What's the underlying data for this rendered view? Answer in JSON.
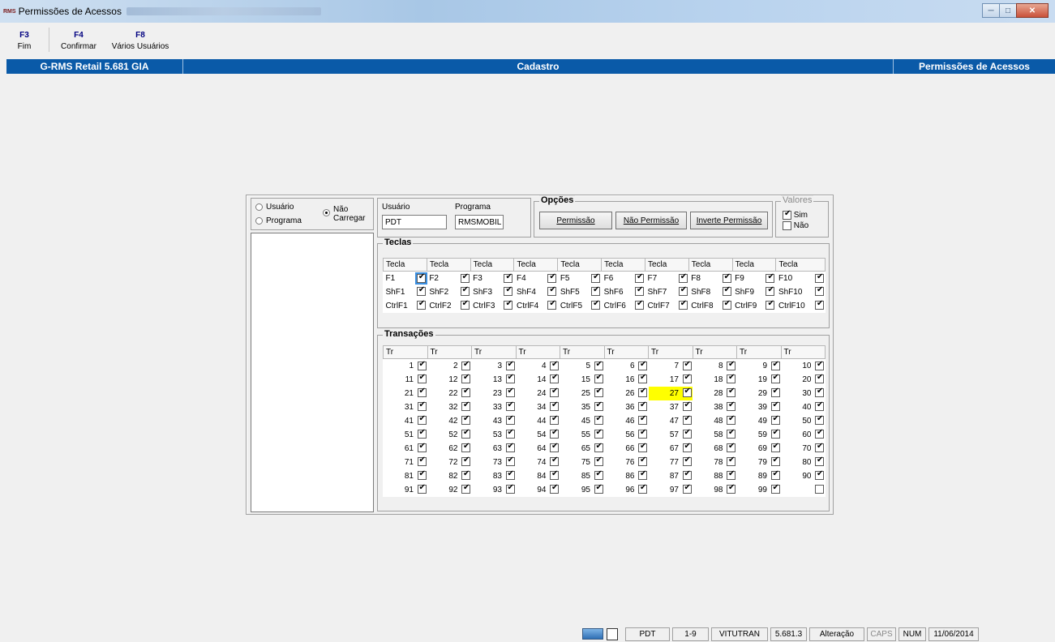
{
  "window": {
    "icon": "RMS",
    "title": "Permissões de Acessos"
  },
  "toolbar": [
    {
      "key": "F3",
      "label": "Fim"
    },
    {
      "key": "F4",
      "label": "Confirmar"
    },
    {
      "key": "F8",
      "label": "Vários Usuários"
    }
  ],
  "header": {
    "left": "G-RMS Retail 5.681 GIA",
    "center": "Cadastro",
    "right": "Permissões de Acessos"
  },
  "mode": {
    "usuario": "Usuário",
    "programa": "Programa",
    "nao_carregar_1": "Não",
    "nao_carregar_2": "Carregar"
  },
  "fields": {
    "usuario_label": "Usuário",
    "usuario_value": "PDT",
    "programa_label": "Programa",
    "programa_value": "RMSMOBIL"
  },
  "opcoes": {
    "legend": "Opções",
    "permissao": "Permissão",
    "nao_permissao": "Não Permissão",
    "inverte": "Inverte Permissão"
  },
  "valores": {
    "legend": "Valores",
    "sim": "Sim",
    "nao": "Não"
  },
  "teclas": {
    "legend": "Teclas",
    "header": "Tecla",
    "rows": [
      [
        "F1",
        "F2",
        "F3",
        "F4",
        "F5",
        "F6",
        "F7",
        "F8",
        "F9",
        "F10"
      ],
      [
        "ShF1",
        "ShF2",
        "ShF3",
        "ShF4",
        "ShF5",
        "ShF6",
        "ShF7",
        "ShF8",
        "ShF9",
        "ShF10"
      ],
      [
        "CtrlF1",
        "CtrlF2",
        "CtrlF3",
        "CtrlF4",
        "CtrlF5",
        "CtrlF6",
        "CtrlF7",
        "CtrlF8",
        "CtrlF9",
        "CtrlF10"
      ]
    ]
  },
  "transacoes": {
    "legend": "Transações",
    "header": "Tr",
    "highlight": 27,
    "last_empty": true
  },
  "status": {
    "user": "PDT",
    "range": "1-9",
    "company": "VITUTRAN",
    "version": "5.681.3",
    "mode": "Alteração",
    "caps": "CAPS",
    "num": "NUM",
    "date": "11/06/2014"
  },
  "icons": {
    "monitor": "monitor-icon",
    "clipboard": "clipboard-icon"
  }
}
